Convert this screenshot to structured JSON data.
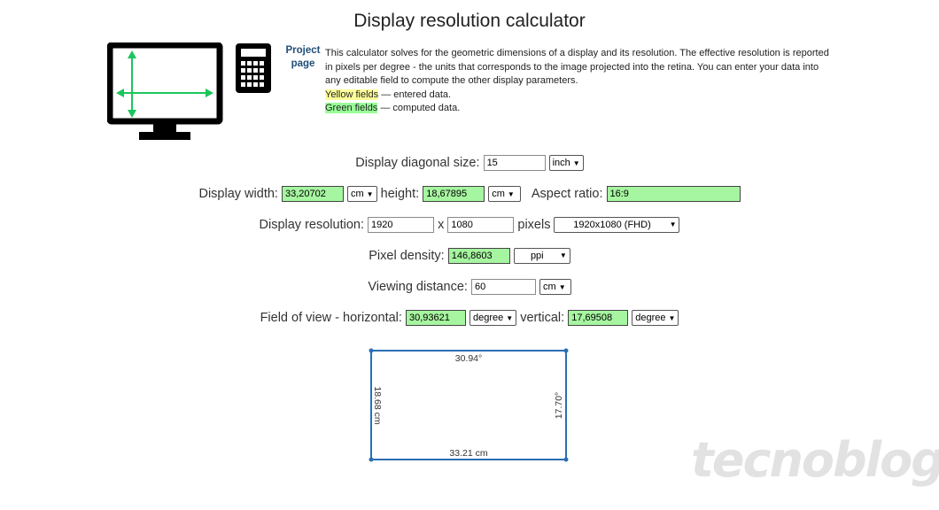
{
  "page_title": "Display resolution calculator",
  "project_link": "Project page",
  "description": {
    "text": "This calculator solves for the geometric dimensions of a display and its resolution. The effective resolution is reported in pixels per degree - the units that corresponds to the image projected into the retina. You can enter your data into any editable field to compute the other display parameters.",
    "yellow_label": "Yellow fields",
    "yellow_text": " — entered data.",
    "green_label": "Green fields",
    "green_text": " — computed data."
  },
  "diagonal": {
    "label": "Display diagonal size:",
    "value": "15",
    "unit": "inch"
  },
  "width_row": {
    "width_label": "Display width:",
    "width_value": "33,20702",
    "width_unit": "cm",
    "height_label": "height:",
    "height_value": "18,67895",
    "height_unit": "cm",
    "aspect_label": "Aspect ratio:",
    "aspect_value": "16:9"
  },
  "resolution": {
    "label": "Display resolution:",
    "width": "1920",
    "x": "x",
    "height": "1080",
    "unit_label": "pixels",
    "preset": "1920x1080 (FHD)"
  },
  "density": {
    "label": "Pixel density:",
    "value": "146,8603",
    "unit": "ppi"
  },
  "viewing": {
    "label": "Viewing distance:",
    "value": "60",
    "unit": "cm"
  },
  "fov": {
    "h_label": "Field of view - horizontal:",
    "h_value": "30,93621",
    "h_unit": "degree",
    "v_label": "vertical:",
    "v_value": "17,69508",
    "v_unit": "degree"
  },
  "diagram": {
    "top": "30.94°",
    "bottom": "33.21 cm",
    "left": "18.68 cm",
    "right": "17.70°"
  },
  "watermark": "tecnoblog",
  "colors": {
    "entered": "#ffff99",
    "computed": "#a6f5a0",
    "link": "#1f4e79",
    "diagram": "#2a6fb3"
  }
}
